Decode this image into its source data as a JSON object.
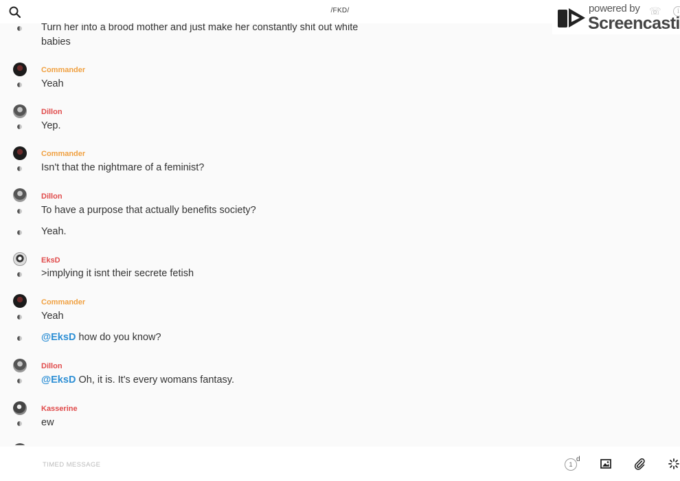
{
  "header": {
    "channel": "/FKD/",
    "watermark": {
      "powered": "powered by",
      "brand": "Screencastify"
    }
  },
  "colors": {
    "commander": "#f0a040",
    "other_user": "#e04b4b",
    "mention": "#2d8fd5"
  },
  "messages": [
    {
      "author": "",
      "text": "Turn her into a brood mother and just make her constantly shit out white babies"
    },
    {
      "author": "Commander",
      "text": "Yeah"
    },
    {
      "author": "Dillon",
      "text": "Yep."
    },
    {
      "author": "Commander",
      "text": "Isn't that the nightmare of a feminist?"
    },
    {
      "author": "Dillon",
      "text": "To have a purpose that actually benefits society?"
    },
    {
      "author": "",
      "text": "Yeah."
    },
    {
      "author": "EksD",
      "text": ">implying it isnt their secrete fetish"
    },
    {
      "author": "Commander",
      "text": "Yeah"
    },
    {
      "author": "",
      "mention": "@EksD",
      "text": " how do you know?"
    },
    {
      "author": "Dillon",
      "mention": "@EksD",
      "text": " Oh, it is. It's every womans fantasy."
    },
    {
      "author": "Kasserine",
      "text": "ew"
    }
  ],
  "composer": {
    "placeholder": "TIMED MESSAGE",
    "timer_value": "1",
    "timer_unit": "d"
  },
  "icons": {
    "search": "search-icon",
    "image": "image-icon",
    "attach": "paperclip-icon",
    "loading": "spinner-icon"
  }
}
